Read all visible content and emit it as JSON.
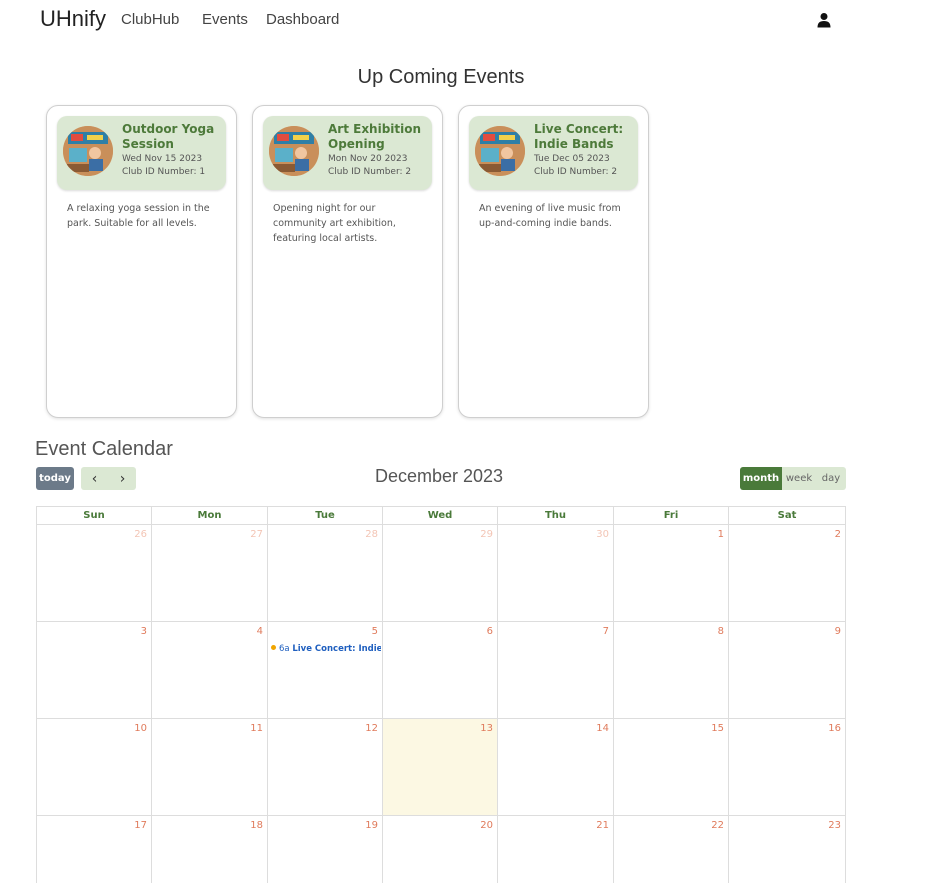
{
  "nav": {
    "brand": "UHnify",
    "links": [
      "ClubHub",
      "Events",
      "Dashboard"
    ]
  },
  "upcoming": {
    "title": "Up Coming Events",
    "events": [
      {
        "title": "Outdoor Yoga Session",
        "date": "Wed Nov 15 2023",
        "club": "Club ID Number: 1",
        "description": "A relaxing yoga session in the park. Suitable for all levels."
      },
      {
        "title": "Art Exhibition Opening",
        "date": "Mon Nov 20 2023",
        "club": "Club ID Number: 2",
        "description": "Opening night for our community art exhibition, featuring local artists."
      },
      {
        "title": "Live Concert: Indie Bands",
        "date": "Tue Dec 05 2023",
        "club": "Club ID Number: 2",
        "description": "An evening of live music from up-and-coming indie bands."
      }
    ]
  },
  "calendar": {
    "title": "Event Calendar",
    "today_label": "today",
    "prev_label": "‹",
    "next_label": "›",
    "month_label": "December 2023",
    "views": [
      "month",
      "week",
      "day"
    ],
    "active_view": "month",
    "weekdays": [
      "Sun",
      "Mon",
      "Tue",
      "Wed",
      "Thu",
      "Fri",
      "Sat"
    ],
    "weeks": [
      [
        "26",
        "27",
        "28",
        "29",
        "30",
        "1",
        "2"
      ],
      [
        "3",
        "4",
        "5",
        "6",
        "7",
        "8",
        "9"
      ],
      [
        "10",
        "11",
        "12",
        "13",
        "14",
        "15",
        "16"
      ],
      [
        "17",
        "18",
        "19",
        "20",
        "21",
        "22",
        "23"
      ]
    ],
    "today_date": "13",
    "event": {
      "time": "6a",
      "title": "Live Concert: Indie Ban"
    },
    "colors": {
      "accent": "#4a7a3a",
      "today_bg": "#fcf8e3",
      "event_dot": "#f0a500",
      "event_text": "#1f5fbf"
    }
  }
}
